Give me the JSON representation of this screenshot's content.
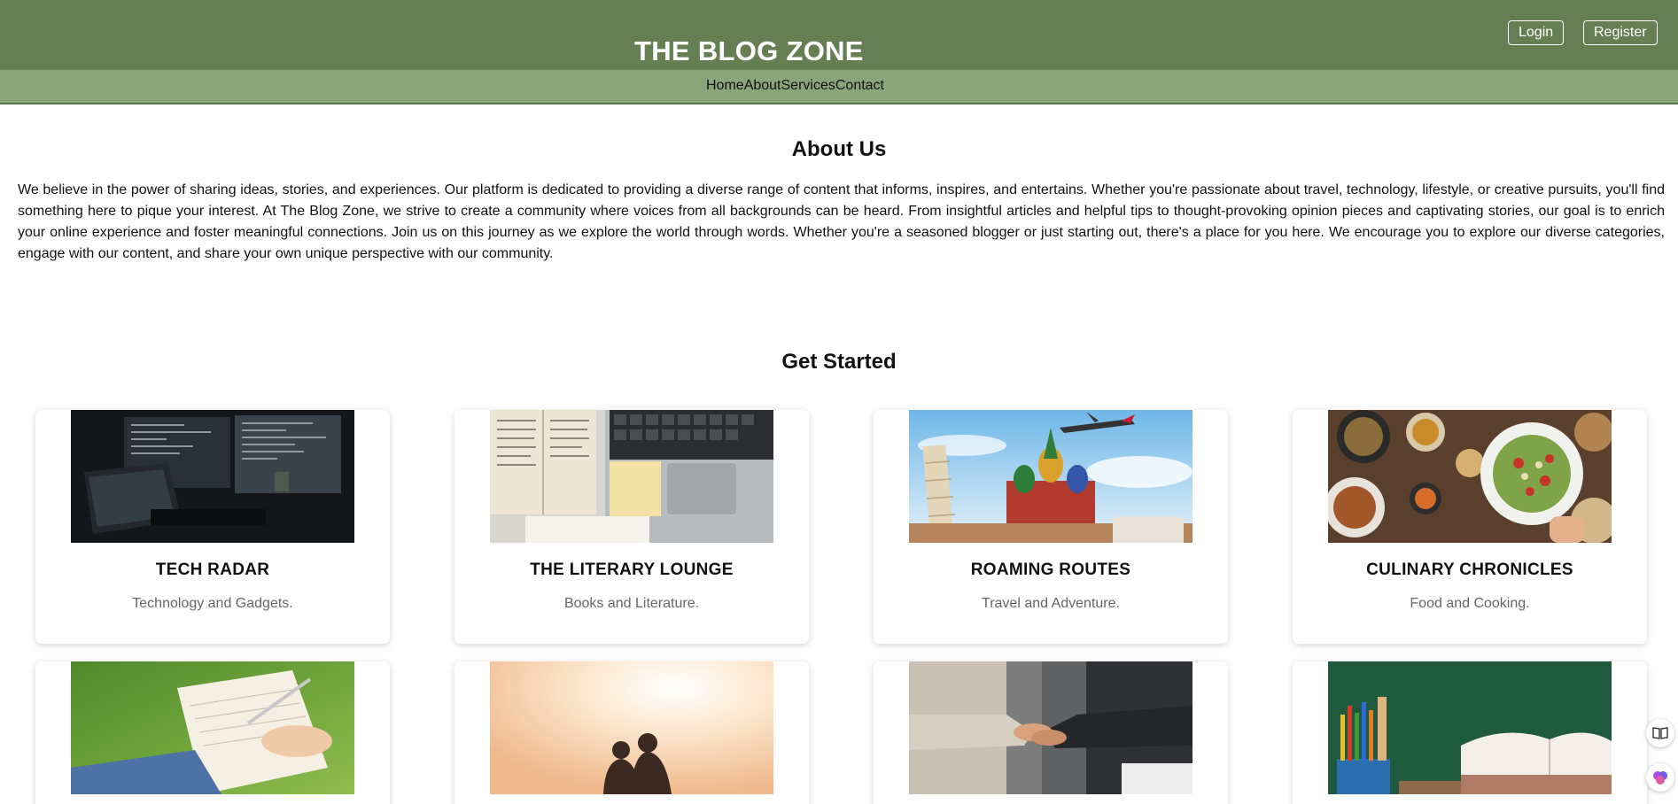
{
  "header": {
    "site_title": "THE BLOG ZONE",
    "login_label": "Login",
    "register_label": "Register",
    "colors": {
      "topbar": "#657f53",
      "navbar": "#8aa579"
    }
  },
  "nav": {
    "items": [
      "Home",
      "About",
      "Services",
      "Contact"
    ]
  },
  "about": {
    "heading": "About Us",
    "body": "We believe in the power of sharing ideas, stories, and experiences. Our platform is dedicated to providing a diverse range of content that informs, inspires, and entertains. Whether you're passionate about travel, technology, lifestyle, or creative pursuits, you'll find something here to pique your interest. At The Blog Zone, we strive to create a community where voices from all backgrounds can be heard. From insightful articles and helpful tips to thought-provoking opinion pieces and captivating stories, our goal is to enrich your online experience and foster meaningful connections. Join us on this journey as we explore the world through words. Whether you're a seasoned blogger or just starting out, there's a place for you here. We encourage you to explore our diverse categories, engage with our content, and share your own unique perspective with our community."
  },
  "get_started": {
    "heading": "Get Started",
    "cards": [
      {
        "title": "TECH RADAR",
        "desc": "Technology and Gadgets.",
        "image": "laptop-code-image"
      },
      {
        "title": "THE LITERARY LOUNGE",
        "desc": "Books and Literature.",
        "image": "book-keyboard-image"
      },
      {
        "title": "ROAMING ROUTES",
        "desc": "Travel and Adventure.",
        "image": "travel-landmarks-image"
      },
      {
        "title": "CULINARY CHRONICLES",
        "desc": "Food and Cooking.",
        "image": "food-table-image"
      },
      {
        "title": "",
        "desc": "",
        "image": "writing-journal-image"
      },
      {
        "title": "",
        "desc": "",
        "image": "sunset-couple-image"
      },
      {
        "title": "",
        "desc": "",
        "image": "handshake-image"
      },
      {
        "title": "",
        "desc": "",
        "image": "books-pencils-image"
      }
    ]
  },
  "side_icons": [
    "book-icon",
    "brain-icon"
  ]
}
